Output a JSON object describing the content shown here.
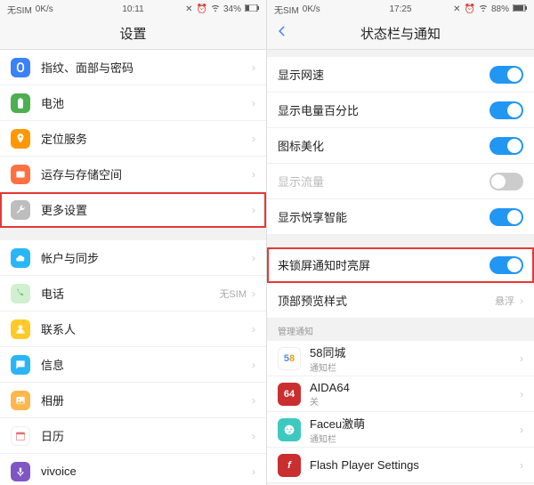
{
  "left": {
    "status": {
      "carrier": "无SIM",
      "speed": "0K/s",
      "time": "10:11",
      "battery": "34%"
    },
    "header": {
      "title": "设置"
    },
    "rows": [
      {
        "label": "指纹、面部与密码"
      },
      {
        "label": "电池"
      },
      {
        "label": "定位服务"
      },
      {
        "label": "运存与存储空间"
      },
      {
        "label": "更多设置"
      },
      {
        "label": "帐户与同步"
      },
      {
        "label": "电话",
        "value": "无SIM"
      },
      {
        "label": "联系人"
      },
      {
        "label": "信息"
      },
      {
        "label": "相册"
      },
      {
        "label": "日历"
      },
      {
        "label": "vivoice"
      }
    ]
  },
  "right": {
    "status": {
      "carrier": "无SIM",
      "speed": "0K/s",
      "time": "17:25",
      "battery": "88%"
    },
    "header": {
      "title": "状态栏与通知"
    },
    "toggles": [
      {
        "label": "显示网速",
        "on": true
      },
      {
        "label": "显示电量百分比",
        "on": true
      },
      {
        "label": "图标美化",
        "on": true
      },
      {
        "label": "显示流量",
        "on": false,
        "disabled": true
      },
      {
        "label": "显示悦享智能",
        "on": true
      }
    ],
    "lockscreen": {
      "label": "来锁屏通知时亮屏",
      "on": true
    },
    "preview": {
      "label": "顶部预览样式",
      "value": "悬浮"
    },
    "manage_label": "管理通知",
    "apps": [
      {
        "name": "58同城",
        "sub": "通知栏",
        "icon_text": "58",
        "bg": "#fff",
        "fg": "#e34"
      },
      {
        "name": "AIDA64",
        "sub": "关",
        "icon_text": "64",
        "bg": "#c92f2f",
        "fg": "#fff"
      },
      {
        "name": "Faceu激萌",
        "sub": "通知栏",
        "icon_text": "",
        "bg": "#3ec9c0",
        "fg": "#fff"
      },
      {
        "name": "Flash Player Settings",
        "sub": "",
        "icon_text": "f",
        "bg": "#c92f2f",
        "fg": "#fff"
      }
    ]
  }
}
